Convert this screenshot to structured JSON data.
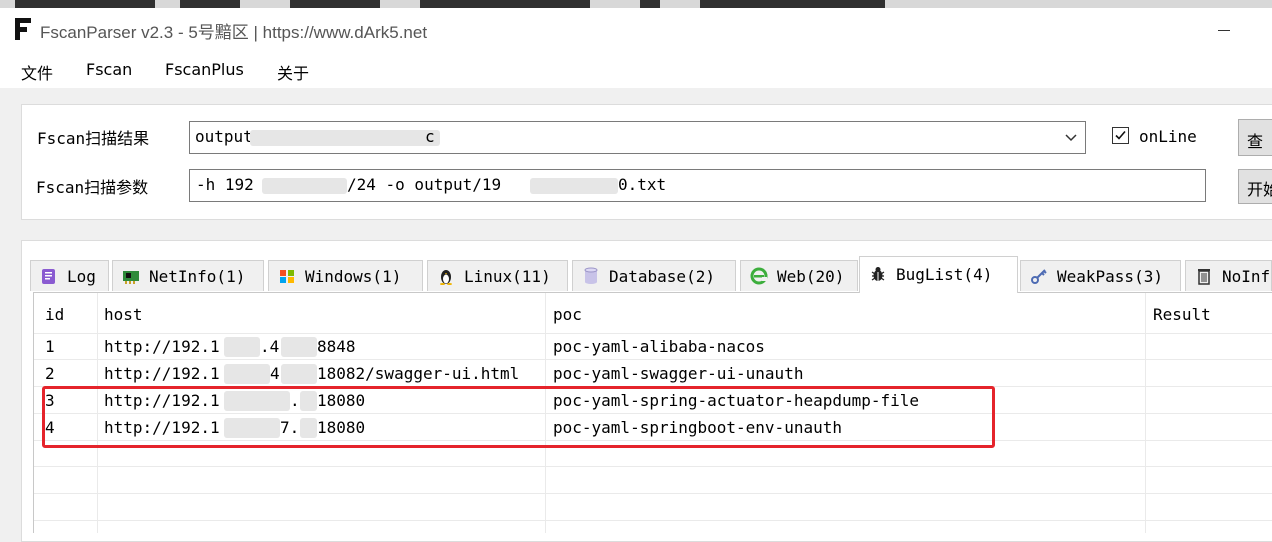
{
  "window": {
    "title": "FscanParser v2.3 - 5号黯区 | https://www.dArk5.net",
    "logo_letter": "F"
  },
  "menu": [
    "文件",
    "Fscan",
    "FscanPlus",
    "关于"
  ],
  "scan_panel": {
    "result_label": "Fscan扫描结果",
    "result_value": "output/",
    "result_value_tail": "c",
    "online_label": "onLine",
    "online_checked": true,
    "load_button": "查",
    "params_label": "Fscan扫描参数",
    "params_value": "-h 192",
    "params_mid": "/24 -o output/19",
    "params_tail": "0.txt",
    "start_button": "开始"
  },
  "tabs": [
    {
      "label": "Log",
      "icon": "log-icon"
    },
    {
      "label": "NetInfo(1)",
      "icon": "network-card-icon"
    },
    {
      "label": "Windows(1)",
      "icon": "windows-icon"
    },
    {
      "label": "Linux(11)",
      "icon": "linux-penguin-icon"
    },
    {
      "label": "Database(2)",
      "icon": "database-icon"
    },
    {
      "label": "Web(20)",
      "icon": "web-icon"
    },
    {
      "label": "BugList(4)",
      "icon": "bug-icon"
    },
    {
      "label": "WeakPass(3)",
      "icon": "key-icon"
    },
    {
      "label": "NoInf",
      "icon": "trash-icon"
    }
  ],
  "active_tab": "BugList(4)",
  "table": {
    "columns": [
      "id",
      "host",
      "poc",
      "Result"
    ],
    "rows": [
      {
        "id": "1",
        "host_a": "http://192.1",
        "host_b": ".4",
        "host_c": "8848",
        "poc": "poc-yaml-alibaba-nacos",
        "result": ""
      },
      {
        "id": "2",
        "host_a": "http://192.1",
        "host_b": "4",
        "host_c": "18082/swagger-ui.html",
        "poc": "poc-yaml-swagger-ui-unauth",
        "result": ""
      },
      {
        "id": "3",
        "host_a": "http://192.1",
        "host_b": ".",
        "host_c": "18080",
        "poc": "poc-yaml-spring-actuator-heapdump-file",
        "result": ""
      },
      {
        "id": "4",
        "host_a": "http://192.1",
        "host_b": "7.",
        "host_c": "18080",
        "poc": "poc-yaml-springboot-env-unauth",
        "result": ""
      }
    ]
  },
  "colors": {
    "highlight_border": "#e5242b",
    "window_bg": "#f0f0f0"
  }
}
